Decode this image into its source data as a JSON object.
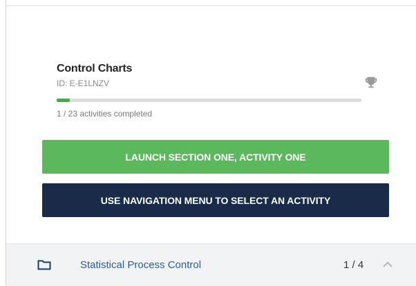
{
  "course": {
    "title": "Control Charts",
    "id_label": "ID: E-E1LNZV",
    "progress_text": "1 / 23 activities completed",
    "progress_completed": 1,
    "progress_total": 23
  },
  "buttons": {
    "launch_label": "LAUNCH SECTION ONE, ACTIVITY ONE",
    "nav_label": "USE NAVIGATION MENU TO SELECT AN ACTIVITY"
  },
  "section": {
    "name": "Statistical Process Control",
    "count": "1 / 4"
  },
  "icons": {
    "trophy": "trophy-icon",
    "folder": "folder-icon",
    "chevron": "chevron-up-icon"
  },
  "colors": {
    "progress": "#3cb043",
    "launch": "#5cb85c",
    "nav": "#1a2b4a",
    "section_link": "#2a5d9f"
  }
}
